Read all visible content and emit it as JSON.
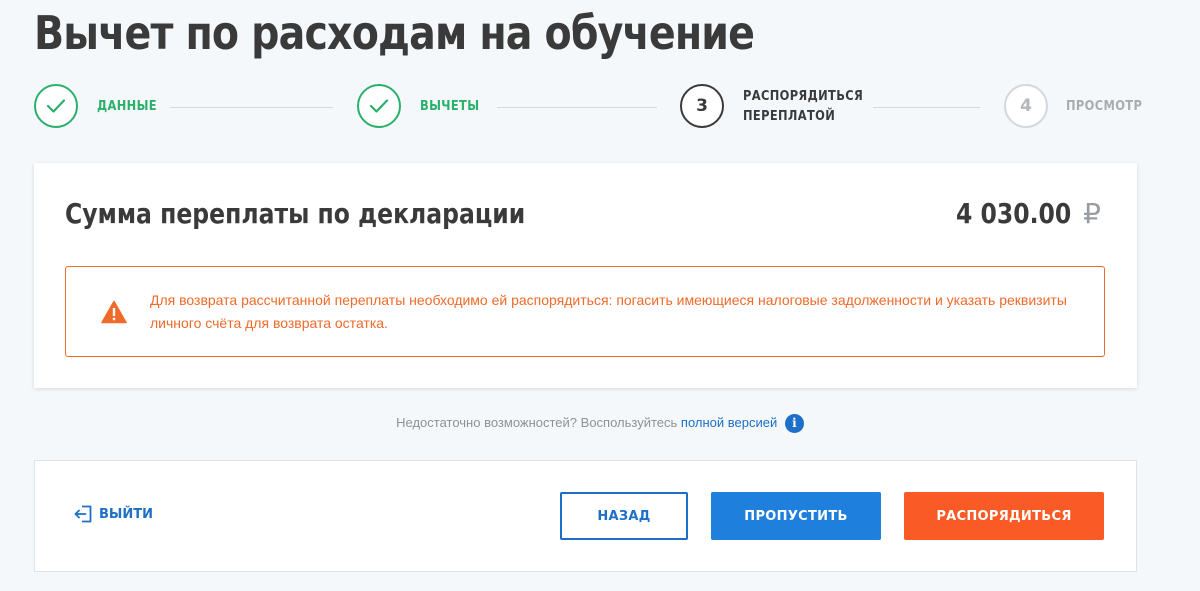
{
  "page": {
    "title": "Вычет по расходам на обучение"
  },
  "steps": [
    {
      "state": "done",
      "number": "",
      "label_lines": [
        "ДАННЫЕ"
      ]
    },
    {
      "state": "done",
      "number": "",
      "label_lines": [
        "ВЫЧЕТЫ"
      ]
    },
    {
      "state": "active",
      "number": "3",
      "label_lines": [
        "РАСПОРЯДИТЬСЯ",
        "ПЕРЕПЛАТОЙ"
      ]
    },
    {
      "state": "future",
      "number": "4",
      "label_lines": [
        "ПРОСМОТР"
      ]
    }
  ],
  "summary": {
    "title": "Сумма переплаты по декларации",
    "amount": "4 030.00",
    "currency": "₽"
  },
  "alert": {
    "icon": "warning-triangle-icon",
    "text": "Для возврата рассчитанной переплаты необходимо ей распорядиться: погасить имеющиеся налоговые задолженности и указать реквизиты личного счёта для возврата остатка."
  },
  "hint": {
    "text": "Недостаточно возможностей? Воспользуйтесь",
    "link": "полной версией",
    "info_icon": "i"
  },
  "actions": {
    "exit_label": "ВЫЙТИ",
    "back_label": "НАЗАД",
    "skip_label": "ПРОПУСТИТЬ",
    "manage_label": "РАСПОРЯДИТЬСЯ"
  },
  "colors": {
    "done_green": "#2bb06b",
    "accent_blue": "#1e7fdc",
    "accent_orange": "#fa5a25",
    "warning_orange": "#f06a2a"
  }
}
